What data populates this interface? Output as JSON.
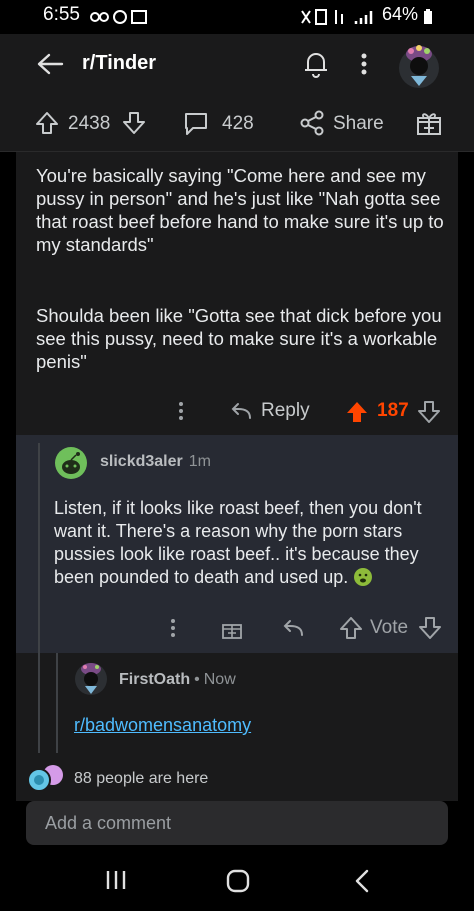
{
  "status_bar": {
    "time": "6:55",
    "battery": "64%"
  },
  "header": {
    "subreddit": "r/Tinder"
  },
  "post_actions": {
    "upvotes": "2438",
    "comments": "428",
    "share_label": "Share"
  },
  "comment1": {
    "paragraphs": [
      "You're basically saying \"Come here and see my pussy in person\" and he's just like \"Nah gotta see that roast beef before hand to make sure it's up to my standards\"",
      "Shoulda been like \"Gotta see that dick before you see this pussy, need to make sure it's a workable penis\""
    ],
    "reply_label": "Reply",
    "score": "187"
  },
  "comment2": {
    "author": "slickd3aler",
    "time": "1m",
    "body": "Listen, if it looks like roast beef, then you don't want it. There's a reason why the porn stars pussies look like roast beef.. it's because they been pounded to death and used up.",
    "vote_label": "Vote"
  },
  "comment3": {
    "author": "FirstOath",
    "time": "Now",
    "link": "r/badwomensanatomy"
  },
  "presence": {
    "text": "88 people are here"
  },
  "add_comment": {
    "placeholder": "Add a comment"
  },
  "colors": {
    "upvote_active": "#ff4500",
    "link": "#4fbcff",
    "avatar_green": "#6fbf5b"
  }
}
